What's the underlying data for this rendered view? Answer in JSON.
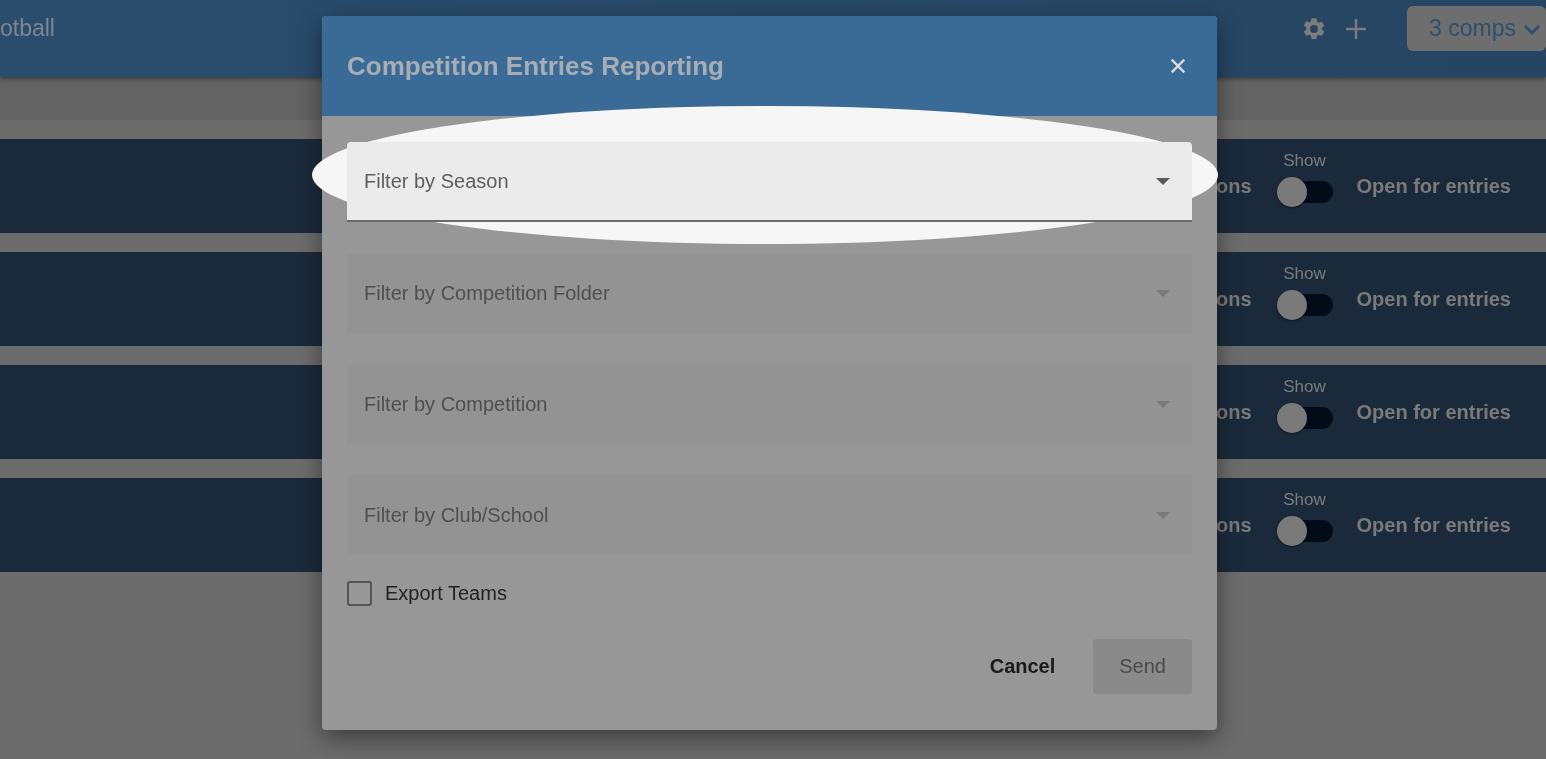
{
  "app_bar": {
    "title": "otball",
    "comp_selector": "3 comps"
  },
  "rows": [
    {
      "label": "ons",
      "toggle_caption": "Show",
      "toggle_on": false,
      "status": "Open for entries"
    },
    {
      "label": "ons",
      "toggle_caption": "Show",
      "toggle_on": false,
      "status": "Open for entries"
    },
    {
      "label": "ons",
      "toggle_caption": "Show",
      "toggle_on": false,
      "status": "Open for entries"
    },
    {
      "label": "ons",
      "toggle_caption": "Show",
      "toggle_on": false,
      "status": "Open for entries"
    }
  ],
  "dialog": {
    "title": "Competition Entries Reporting",
    "fields": [
      {
        "placeholder": "Filter by Season",
        "highlighted": true,
        "disabled": false
      },
      {
        "placeholder": "Filter by Competition Folder",
        "highlighted": false,
        "disabled": true
      },
      {
        "placeholder": "Filter by Competition",
        "highlighted": false,
        "disabled": true
      },
      {
        "placeholder": "Filter by Club/School",
        "highlighted": false,
        "disabled": true
      }
    ],
    "checkbox": {
      "label": "Export Teams",
      "checked": false
    },
    "buttons": [
      {
        "label": "Cancel",
        "kind": "text",
        "disabled": false
      },
      {
        "label": "Send",
        "kind": "contained",
        "disabled": true
      }
    ]
  }
}
